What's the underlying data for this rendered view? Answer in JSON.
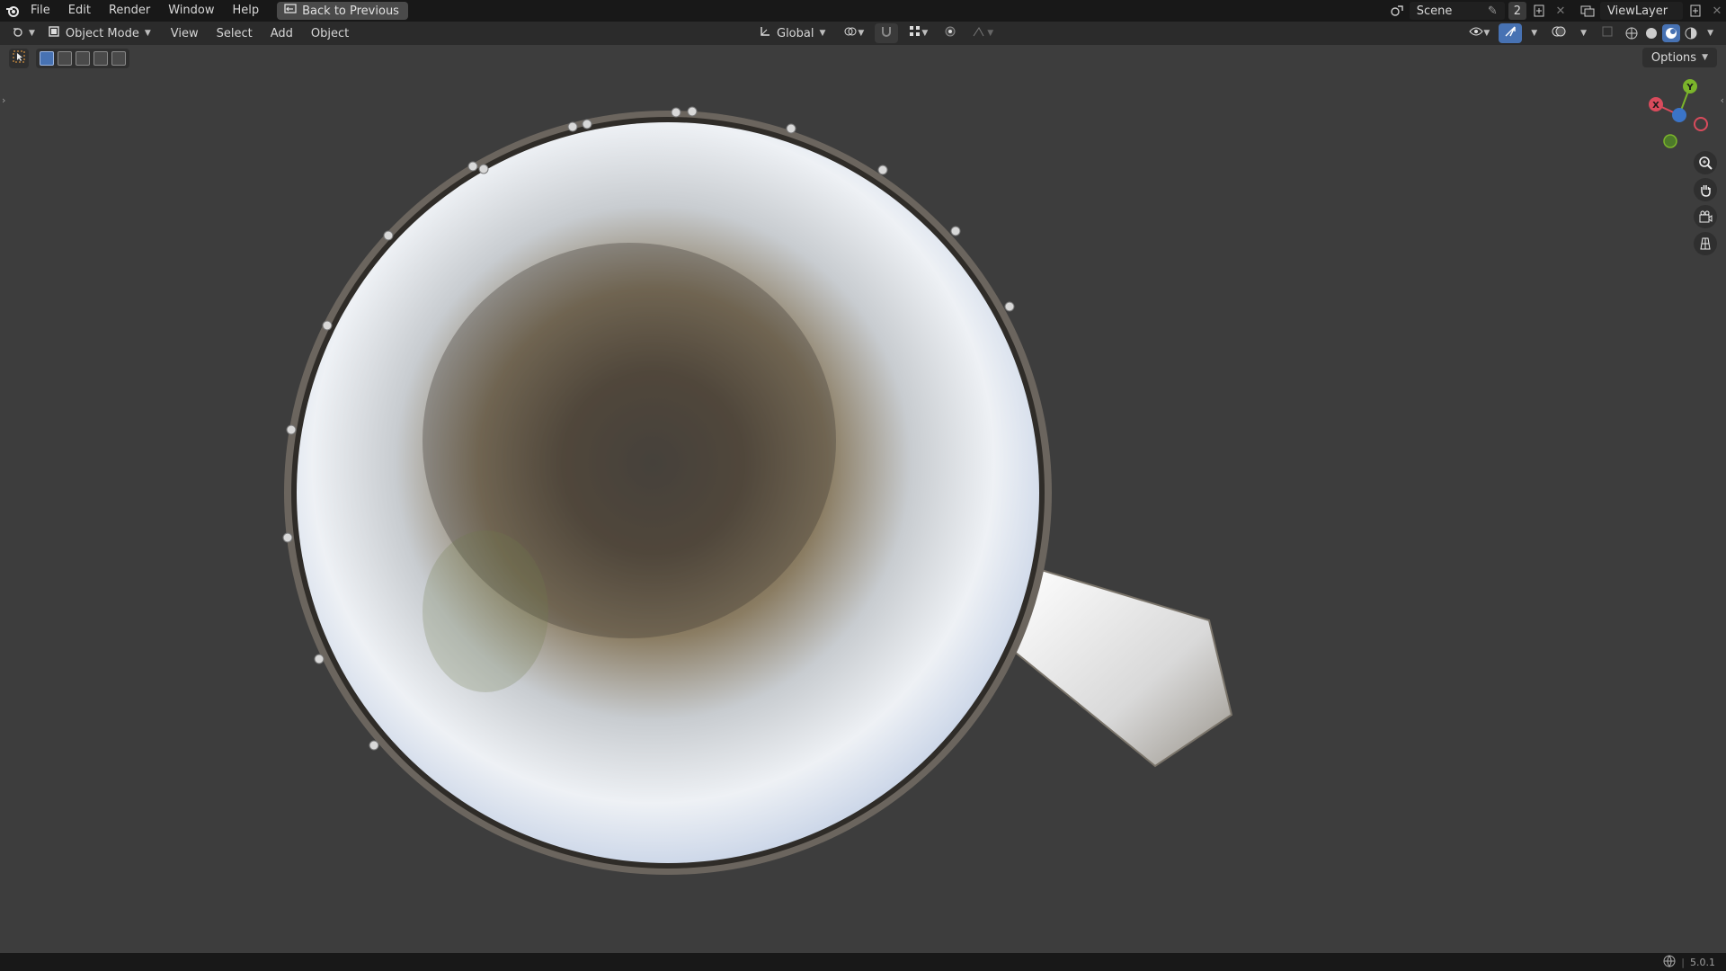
{
  "menu": {
    "file": "File",
    "edit": "Edit",
    "render": "Render",
    "window": "Window",
    "help": "Help",
    "back_to_previous": "Back to Previous"
  },
  "topright": {
    "scene": "Scene",
    "scene_users": "2",
    "view_layer": "ViewLayer"
  },
  "header": {
    "mode": "Object Mode",
    "view": "View",
    "select": "Select",
    "add": "Add",
    "object": "Object",
    "orientation": "Global",
    "options": "Options"
  },
  "gizmo": {
    "x": "X",
    "y": "Y"
  },
  "status": {
    "version": "5.0.1"
  },
  "colors": {
    "accent": "#4772b3",
    "axis_x": "#d94b5c",
    "axis_y": "#7bb52b",
    "axis_z": "#3b74c7"
  }
}
